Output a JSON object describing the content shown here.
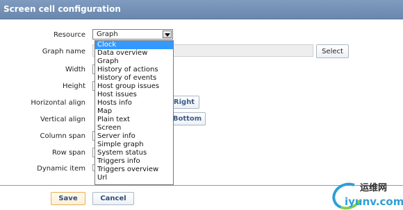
{
  "header": {
    "title": "Screen cell configuration"
  },
  "form": {
    "resource_label": "Resource",
    "resource_value": "Graph",
    "graph_name_label": "Graph name",
    "graph_name_value": "",
    "select_button": "Select",
    "width_label": "Width",
    "height_label": "Height",
    "halign_label": "Horizontal align",
    "halign_right": "Right",
    "valign_label": "Vertical align",
    "valign_bottom": "Bottom",
    "colspan_label": "Column span",
    "rowspan_label": "Row span",
    "dynamic_label": "Dynamic item"
  },
  "dropdown": {
    "items": [
      "Clock",
      "Data overview",
      "Graph",
      "History of actions",
      "History of events",
      "Host group issues",
      "Host issues",
      "Hosts info",
      "Map",
      "Plain text",
      "Screen",
      "Server info",
      "Simple graph",
      "System status",
      "Triggers info",
      "Triggers overview",
      "Url"
    ],
    "highlighted": "Clock"
  },
  "footer": {
    "save": "Save",
    "cancel": "Cancel"
  },
  "watermark": {
    "text_cn": "运维网",
    "url": "iyunv.com"
  },
  "colors": {
    "header": "#7390b5",
    "highlight": "#3399ff",
    "save_border": "#e6b05a"
  }
}
